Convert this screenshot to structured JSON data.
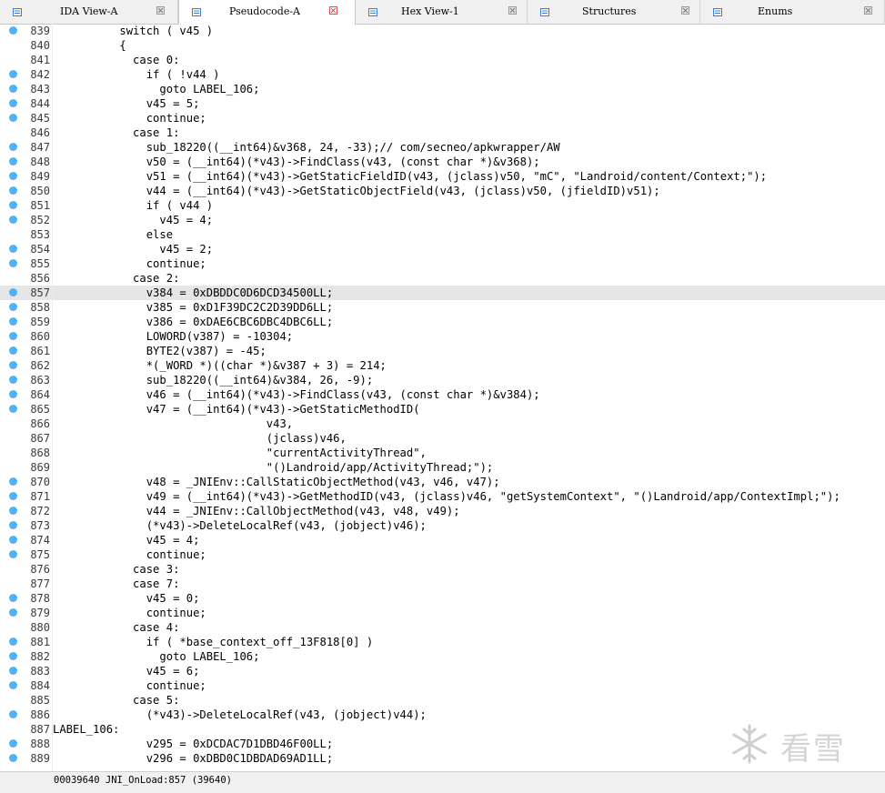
{
  "tabs": [
    {
      "label": "IDA View-A",
      "icon": "disassembly-view-icon",
      "active": false
    },
    {
      "label": "Pseudocode-A",
      "icon": "pseudocode-icon",
      "active": true
    },
    {
      "label": "Hex View-1",
      "icon": "hex-view-icon",
      "active": false
    },
    {
      "label": "Structures",
      "icon": "structures-icon",
      "active": false
    },
    {
      "label": "Enums",
      "icon": "enums-icon",
      "active": false
    }
  ],
  "code": {
    "current_line": "857",
    "lines": [
      {
        "n": "839",
        "bp": true,
        "t": "          switch ( v45 )"
      },
      {
        "n": "840",
        "bp": false,
        "t": "          {"
      },
      {
        "n": "841",
        "bp": false,
        "t": "            case 0:"
      },
      {
        "n": "842",
        "bp": true,
        "t": "              if ( !v44 )"
      },
      {
        "n": "843",
        "bp": true,
        "t": "                goto LABEL_106;"
      },
      {
        "n": "844",
        "bp": true,
        "t": "              v45 = 5;"
      },
      {
        "n": "845",
        "bp": true,
        "t": "              continue;"
      },
      {
        "n": "846",
        "bp": false,
        "t": "            case 1:"
      },
      {
        "n": "847",
        "bp": true,
        "t": "              sub_18220((__int64)&v368, 24, -33);// com/secneo/apkwrapper/AW"
      },
      {
        "n": "848",
        "bp": true,
        "t": "              v50 = (__int64)(*v43)->FindClass(v43, (const char *)&v368);"
      },
      {
        "n": "849",
        "bp": true,
        "t": "              v51 = (__int64)(*v43)->GetStaticFieldID(v43, (jclass)v50, \"mC\", \"Landroid/content/Context;\");"
      },
      {
        "n": "850",
        "bp": true,
        "t": "              v44 = (__int64)(*v43)->GetStaticObjectField(v43, (jclass)v50, (jfieldID)v51);"
      },
      {
        "n": "851",
        "bp": true,
        "t": "              if ( v44 )"
      },
      {
        "n": "852",
        "bp": true,
        "t": "                v45 = 4;"
      },
      {
        "n": "853",
        "bp": false,
        "t": "              else"
      },
      {
        "n": "854",
        "bp": true,
        "t": "                v45 = 2;"
      },
      {
        "n": "855",
        "bp": true,
        "t": "              continue;"
      },
      {
        "n": "856",
        "bp": false,
        "t": "            case 2:"
      },
      {
        "n": "857",
        "bp": true,
        "t": "              v384 = 0xDBDDC0D6DCD34500LL;"
      },
      {
        "n": "858",
        "bp": true,
        "t": "              v385 = 0xD1F39DC2C2D39DD6LL;"
      },
      {
        "n": "859",
        "bp": true,
        "t": "              v386 = 0xDAE6CBC6DBC4DBC6LL;"
      },
      {
        "n": "860",
        "bp": true,
        "t": "              LOWORD(v387) = -10304;"
      },
      {
        "n": "861",
        "bp": true,
        "t": "              BYTE2(v387) = -45;"
      },
      {
        "n": "862",
        "bp": true,
        "t": "              *(_WORD *)((char *)&v387 + 3) = 214;"
      },
      {
        "n": "863",
        "bp": true,
        "t": "              sub_18220((__int64)&v384, 26, -9);"
      },
      {
        "n": "864",
        "bp": true,
        "t": "              v46 = (__int64)(*v43)->FindClass(v43, (const char *)&v384);"
      },
      {
        "n": "865",
        "bp": true,
        "t": "              v47 = (__int64)(*v43)->GetStaticMethodID("
      },
      {
        "n": "866",
        "bp": false,
        "t": "                                v43,"
      },
      {
        "n": "867",
        "bp": false,
        "t": "                                (jclass)v46,"
      },
      {
        "n": "868",
        "bp": false,
        "t": "                                \"currentActivityThread\","
      },
      {
        "n": "869",
        "bp": false,
        "t": "                                \"()Landroid/app/ActivityThread;\");"
      },
      {
        "n": "870",
        "bp": true,
        "t": "              v48 = _JNIEnv::CallStaticObjectMethod(v43, v46, v47);"
      },
      {
        "n": "871",
        "bp": true,
        "t": "              v49 = (__int64)(*v43)->GetMethodID(v43, (jclass)v46, \"getSystemContext\", \"()Landroid/app/ContextImpl;\");"
      },
      {
        "n": "872",
        "bp": true,
        "t": "              v44 = _JNIEnv::CallObjectMethod(v43, v48, v49);"
      },
      {
        "n": "873",
        "bp": true,
        "t": "              (*v43)->DeleteLocalRef(v43, (jobject)v46);"
      },
      {
        "n": "874",
        "bp": true,
        "t": "              v45 = 4;"
      },
      {
        "n": "875",
        "bp": true,
        "t": "              continue;"
      },
      {
        "n": "876",
        "bp": false,
        "t": "            case 3:"
      },
      {
        "n": "877",
        "bp": false,
        "t": "            case 7:"
      },
      {
        "n": "878",
        "bp": true,
        "t": "              v45 = 0;"
      },
      {
        "n": "879",
        "bp": true,
        "t": "              continue;"
      },
      {
        "n": "880",
        "bp": false,
        "t": "            case 4:"
      },
      {
        "n": "881",
        "bp": true,
        "t": "              if ( *base_context_off_13F818[0] )"
      },
      {
        "n": "882",
        "bp": true,
        "t": "                goto LABEL_106;"
      },
      {
        "n": "883",
        "bp": true,
        "t": "              v45 = 6;"
      },
      {
        "n": "884",
        "bp": true,
        "t": "              continue;"
      },
      {
        "n": "885",
        "bp": false,
        "t": "            case 5:"
      },
      {
        "n": "886",
        "bp": true,
        "t": "              (*v43)->DeleteLocalRef(v43, (jobject)v44);"
      },
      {
        "n": "887",
        "bp": false,
        "t": "LABEL_106:"
      },
      {
        "n": "888",
        "bp": true,
        "t": "              v295 = 0xDCDAC7D1DBD46F00LL;"
      },
      {
        "n": "889",
        "bp": true,
        "t": "              v296 = 0xDBD0C1DBDAD69AD1LL;"
      }
    ]
  },
  "status": {
    "text": "00039640 JNI_OnLoad:857 (39640)"
  },
  "watermark": {
    "text": "看雪",
    "icon": "snowflake-icon"
  },
  "colors": {
    "breakpoint": "#52b1f3",
    "current_line": "#e6e6e6",
    "close_active": "#d9534f"
  }
}
